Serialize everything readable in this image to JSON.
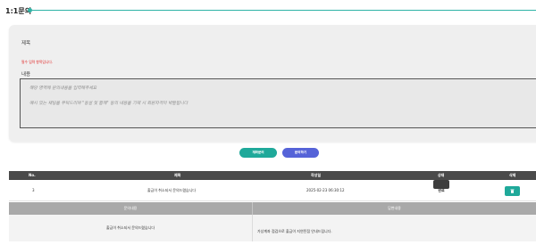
{
  "page": {
    "title": "1:1문의"
  },
  "form": {
    "subject_label": "제목",
    "subject_value": "",
    "required_msg": "필수 입력 항목입니다.",
    "content_label": "내용",
    "content_placeholder_1": "해당 영역에 문의내용을 입력해주세요",
    "content_placeholder_2": "예시 있는 채팅을 부탁드리며 \"등설 및 함께\" 등의 내용을 기재 시 회원자격이 박탈됩니다"
  },
  "buttons": {
    "delete_inquiry": "계좌문의",
    "write_inquiry": "문의하기"
  },
  "table": {
    "headers": {
      "no": "No.",
      "subject": "제목",
      "date": "작성일",
      "status": "상태",
      "delete": "삭제"
    },
    "rows": [
      {
        "no": "3",
        "subject": "출금이 취소되서 문의드렸습니다",
        "date": "2025-02-23 06:30:12",
        "status": "완료",
        "question_header": "문의내용",
        "answer_header": "답변내용",
        "question": "출금이 취소되서 문의드렸습니다",
        "answer": "가상계좌 점검으로 출금이 지연된점 안내드립니다."
      }
    ]
  },
  "colors": {
    "accent_teal": "#1fa99a",
    "accent_blue": "#5563d8",
    "header_dark": "#4a4a4a",
    "required_red": "#e02020"
  },
  "icons": {
    "trash": "trash-icon"
  }
}
